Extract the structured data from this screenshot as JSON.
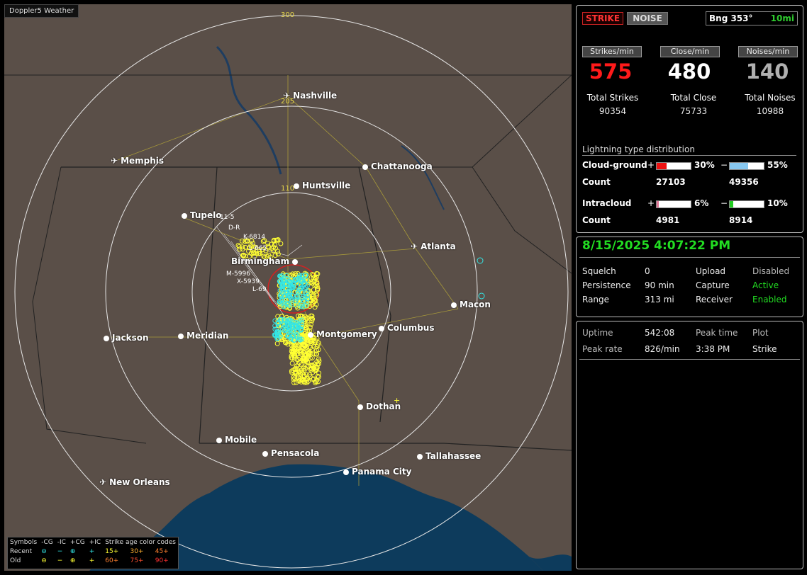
{
  "map": {
    "title": "Doppler5 Weather",
    "range_labels": [
      "300",
      "205",
      "110"
    ],
    "cities": [
      {
        "name": "Nashville",
        "type": "airport"
      },
      {
        "name": "Memphis",
        "type": "airport"
      },
      {
        "name": "Chattanooga",
        "type": "city"
      },
      {
        "name": "Huntsville",
        "type": "city"
      },
      {
        "name": "Tupelo",
        "type": "city"
      },
      {
        "name": "Birmingham",
        "type": "city"
      },
      {
        "name": "Atlanta",
        "type": "airport"
      },
      {
        "name": "Macon",
        "type": "city"
      },
      {
        "name": "Jackson",
        "type": "city"
      },
      {
        "name": "Meridian",
        "type": "city"
      },
      {
        "name": "Montgomery",
        "type": "city"
      },
      {
        "name": "Columbus",
        "type": "city"
      },
      {
        "name": "Dothan",
        "type": "city"
      },
      {
        "name": "Mobile",
        "type": "city"
      },
      {
        "name": "Pensacola",
        "type": "city"
      },
      {
        "name": "Tallahassee",
        "type": "city"
      },
      {
        "name": "Panama City",
        "type": "city"
      },
      {
        "name": "New Orleans",
        "type": "airport"
      }
    ],
    "storm_labels": [
      "11-5",
      "D-R",
      "K-6814",
      "L-665",
      "M-5996",
      "X-5939",
      "L-69"
    ],
    "legend": {
      "header": [
        "Symbols",
        "-CG",
        "-IC",
        "+CG",
        "+IC",
        "Strike age color codes"
      ],
      "recent_label": "Recent",
      "old_label": "Old",
      "recent_ages": [
        "15+",
        "30+",
        "45+"
      ],
      "old_ages": [
        "60+",
        "75+",
        "90+"
      ]
    }
  },
  "panel": {
    "strike_button": "STRIKE",
    "noise_button": "NOISE",
    "bearing_label": "Bng 353°",
    "bearing_range": "10mi",
    "stats": [
      {
        "head": "Strikes/min",
        "value": "575",
        "total_label": "Total Strikes",
        "total": "90354",
        "color": "#ff1a1a"
      },
      {
        "head": "Close/min",
        "value": "480",
        "total_label": "Total Close",
        "total": "75733",
        "color": "#ffffff"
      },
      {
        "head": "Noises/min",
        "value": "140",
        "total_label": "Total Noises",
        "total": "10988",
        "color": "#b0b0b0"
      }
    ],
    "distribution": {
      "title": "Lightning type distribution",
      "cloud_ground": {
        "label": "Cloud-ground",
        "pos_pct": "30%",
        "neg_pct": "55%",
        "pos_fill": 0.3,
        "neg_fill": 0.55,
        "count_label": "Count",
        "pos_count": "27103",
        "neg_count": "49356"
      },
      "intracloud": {
        "label": "Intracloud",
        "pos_pct": "6%",
        "neg_pct": "10%",
        "pos_fill": 0.06,
        "neg_fill": 0.1,
        "count_label": "Count",
        "pos_count": "4981",
        "neg_count": "8914"
      }
    },
    "status": {
      "datetime": "8/15/2025 4:07:22 PM",
      "squelch_label": "Squelch",
      "squelch": "0",
      "persistence_label": "Persistence",
      "persistence": "90 min",
      "range_label": "Range",
      "range": "313 mi",
      "upload_label": "Upload",
      "upload": "Disabled",
      "capture_label": "Capture",
      "capture": "Active",
      "receiver_label": "Receiver",
      "receiver": "Enabled"
    },
    "runtime": {
      "uptime_label": "Uptime",
      "uptime": "542:08",
      "peak_time_label": "Peak time",
      "peak_time": "3:38 PM",
      "plot_label": "Plot",
      "plot": "Strike",
      "peak_rate_label": "Peak rate",
      "peak_rate": "826/min"
    }
  },
  "colors": {
    "land": "#5a4f48",
    "water": "#0d3b5c",
    "strike_recent": "#ffff33",
    "strike_ic": "#33e6e6"
  }
}
